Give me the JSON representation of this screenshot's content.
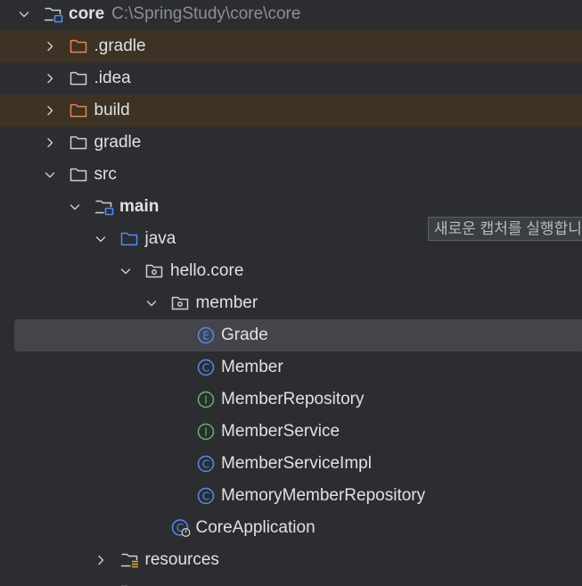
{
  "tree": {
    "nodes": [
      {
        "name": "core",
        "detail": "C:\\SpringStudy\\core\\core",
        "depth": 0,
        "expanded": true,
        "icon": "module-folder-icon",
        "name_bold": true
      },
      {
        "name": ".gradle",
        "depth": 1,
        "expanded": false,
        "icon": "excluded-folder-icon",
        "highlight": "excluded"
      },
      {
        "name": ".idea",
        "depth": 1,
        "expanded": false,
        "icon": "folder-icon"
      },
      {
        "name": "build",
        "depth": 1,
        "expanded": false,
        "icon": "excluded-folder-icon",
        "highlight": "excluded"
      },
      {
        "name": "gradle",
        "depth": 1,
        "expanded": false,
        "icon": "folder-icon"
      },
      {
        "name": "src",
        "depth": 1,
        "expanded": true,
        "icon": "folder-icon"
      },
      {
        "name": "main",
        "depth": 2,
        "expanded": true,
        "icon": "module-folder-icon",
        "name_bold": true
      },
      {
        "name": "java",
        "depth": 3,
        "expanded": true,
        "icon": "source-root-folder-icon"
      },
      {
        "name": "hello.core",
        "depth": 4,
        "expanded": true,
        "icon": "package-icon"
      },
      {
        "name": "member",
        "depth": 5,
        "expanded": true,
        "icon": "package-icon"
      },
      {
        "name": "Grade",
        "depth": 6,
        "icon": "enum-icon",
        "selected": true
      },
      {
        "name": "Member",
        "depth": 6,
        "icon": "class-icon"
      },
      {
        "name": "MemberRepository",
        "depth": 6,
        "icon": "interface-icon"
      },
      {
        "name": "MemberService",
        "depth": 6,
        "icon": "interface-icon"
      },
      {
        "name": "MemberServiceImpl",
        "depth": 6,
        "icon": "class-icon"
      },
      {
        "name": "MemoryMemberRepository",
        "depth": 6,
        "icon": "class-icon"
      },
      {
        "name": "CoreApplication",
        "depth": 5,
        "icon": "spring-boot-class-icon"
      },
      {
        "name": "resources",
        "depth": 3,
        "expanded": false,
        "icon": "resources-folder-icon"
      },
      {
        "name": "",
        "depth": 3,
        "icon": "folder-icon"
      }
    ]
  },
  "tooltip": {
    "text": "새로운 캡처를 실행합니다"
  },
  "colors": {
    "background": "#2b2d30",
    "selected_row": "#43454a",
    "excluded_row": "#3d3223",
    "text": "#dfe1e5",
    "path_text": "#8c8f94",
    "class_icon": "#548af7",
    "interface_icon": "#5fb865",
    "excluded_folder": "#e08855",
    "source_folder": "#548af7"
  }
}
